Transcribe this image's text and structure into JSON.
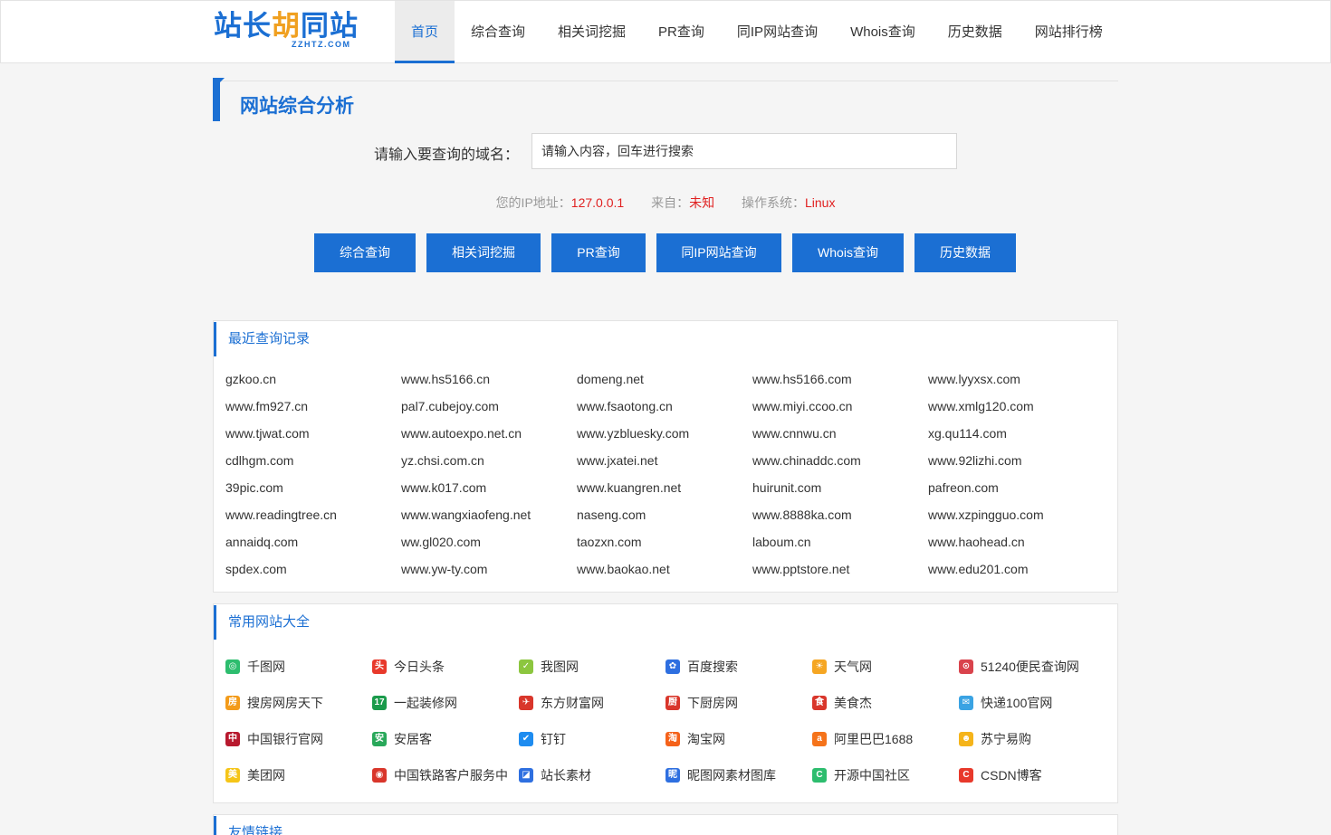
{
  "logo": {
    "text_a": "站长",
    "text_b": "胡",
    "text_c": "同站",
    "sub": "ZZHTZ.COM"
  },
  "nav": [
    {
      "label": "首页"
    },
    {
      "label": "综合查询"
    },
    {
      "label": "相关词挖掘"
    },
    {
      "label": "PR查询"
    },
    {
      "label": "同IP网站查询"
    },
    {
      "label": "Whois查询"
    },
    {
      "label": "历史数据"
    },
    {
      "label": "网站排行榜"
    }
  ],
  "page_title": "网站综合分析",
  "search": {
    "label": "请输入要查询的域名：",
    "placeholder": "请输入内容，回车进行搜索",
    "value": ""
  },
  "ipinfo": {
    "ip_label": "您的IP地址：",
    "ip_value": "127.0.0.1",
    "from_label": "来自：",
    "from_value": "未知",
    "os_label": "操作系统：",
    "os_value": "Linux"
  },
  "buttons": [
    {
      "label": "综合查询"
    },
    {
      "label": "相关词挖掘"
    },
    {
      "label": "PR查询"
    },
    {
      "label": "同IP网站查询"
    },
    {
      "label": "Whois查询"
    },
    {
      "label": "历史数据"
    }
  ],
  "recent": {
    "title": "最近查询记录",
    "items": [
      "gzkoo.cn",
      "www.hs5166.cn",
      "domeng.net",
      "www.hs5166.com",
      "www.lyyxsx.com",
      "www.fm927.cn",
      "pal7.cubejoy.com",
      "www.fsaotong.cn",
      "www.miyi.ccoo.cn",
      "www.xmlg120.com",
      "www.tjwat.com",
      "www.autoexpo.net.cn",
      "www.yzbluesky.com",
      "www.cnnwu.cn",
      "xg.qu114.com",
      "cdlhgm.com",
      "yz.chsi.com.cn",
      "www.jxatei.net",
      "www.chinaddc.com",
      "www.92lizhi.com",
      "39pic.com",
      "www.k017.com",
      "www.kuangren.net",
      "huirunit.com",
      "pafreon.com",
      "www.readingtree.cn",
      "www.wangxiaofeng.net",
      "naseng.com",
      "www.8888ka.com",
      "www.xzpingguo.com",
      "annaidq.com",
      "ww.gl020.com",
      "taozxn.com",
      "laboum.cn",
      "www.haohead.cn",
      "spdex.com",
      "www.yw-ty.com",
      "www.baokao.net",
      "www.pptstore.net",
      "www.edu201.com"
    ]
  },
  "sites": {
    "title": "常用网站大全",
    "items": [
      {
        "label": "千图网",
        "icon": "qiantu-icon",
        "color": "#2dbd6e",
        "glyph": "◎"
      },
      {
        "label": "今日头条",
        "icon": "toutiao-icon",
        "color": "#e8392b",
        "glyph": "头"
      },
      {
        "label": "我图网",
        "icon": "wotu-icon",
        "color": "#8cc63f",
        "glyph": "✓"
      },
      {
        "label": "百度搜索",
        "icon": "baidu-icon",
        "color": "#2e6fe0",
        "glyph": "✿"
      },
      {
        "label": "天气网",
        "icon": "tianqi-icon",
        "color": "#f5a623",
        "glyph": "☀"
      },
      {
        "label": "51240便民查询网",
        "icon": "51240-icon",
        "color": "#d9434c",
        "glyph": "⊙"
      },
      {
        "label": "搜房网房天下",
        "icon": "soufang-icon",
        "color": "#f39b1a",
        "glyph": "房"
      },
      {
        "label": "一起装修网",
        "icon": "17zhuangxiu-icon",
        "color": "#1a9b4b",
        "glyph": "17"
      },
      {
        "label": "东方财富网",
        "icon": "eastmoney-icon",
        "color": "#d9362b",
        "glyph": "✈"
      },
      {
        "label": "下厨房网",
        "icon": "xiachufang-icon",
        "color": "#d9362b",
        "glyph": "厨"
      },
      {
        "label": "美食杰",
        "icon": "meishij-icon",
        "color": "#d9362b",
        "glyph": "食"
      },
      {
        "label": "快递100官网",
        "icon": "kuaidi100-icon",
        "color": "#3aa3e3",
        "glyph": "✉"
      },
      {
        "label": "中国银行官网",
        "icon": "boc-icon",
        "color": "#b8192e",
        "glyph": "中"
      },
      {
        "label": "安居客",
        "icon": "anjuke-icon",
        "color": "#29a85a",
        "glyph": "安"
      },
      {
        "label": "钉钉",
        "icon": "dingtalk-icon",
        "color": "#1e8cf0",
        "glyph": "✔"
      },
      {
        "label": "淘宝网",
        "icon": "taobao-icon",
        "color": "#f5621a",
        "glyph": "淘"
      },
      {
        "label": "阿里巴巴1688",
        "icon": "alibaba-icon",
        "color": "#f5731a",
        "glyph": "a"
      },
      {
        "label": "苏宁易购",
        "icon": "suning-icon",
        "color": "#f5b41a",
        "glyph": "☻"
      },
      {
        "label": "美团网",
        "icon": "meituan-icon",
        "color": "#f5c518",
        "glyph": "美"
      },
      {
        "label": "中国铁路客户服务中",
        "icon": "12306-icon",
        "color": "#d9362b",
        "glyph": "◉"
      },
      {
        "label": "站长素材",
        "icon": "sccnn-icon",
        "color": "#2e6fe0",
        "glyph": "◪"
      },
      {
        "label": "昵图网素材图库",
        "icon": "nipic-icon",
        "color": "#2e6fe0",
        "glyph": "昵"
      },
      {
        "label": "开源中国社区",
        "icon": "oschina-icon",
        "color": "#2dbd6e",
        "glyph": "C"
      },
      {
        "label": "CSDN博客",
        "icon": "csdn-icon",
        "color": "#e8392b",
        "glyph": "C"
      }
    ]
  },
  "links": {
    "title": "友情链接"
  }
}
